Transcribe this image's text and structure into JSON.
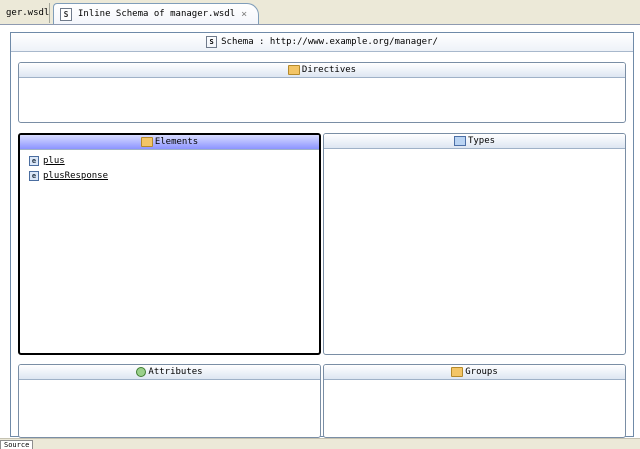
{
  "tabs": [
    {
      "label": "ger.wsdl",
      "active": false
    },
    {
      "label": "Inline Schema of manager.wsdl",
      "active": true,
      "icon": "schema-icon",
      "close": "×"
    }
  ],
  "schema": {
    "icon_letter": "S",
    "title": "Schema : http://www.example.org/manager/"
  },
  "sections": {
    "directives": {
      "title": "Directives",
      "icon": "folder-icon"
    },
    "elements": {
      "title": "Elements",
      "icon": "folder-icon",
      "items": [
        {
          "icon": "element-icon",
          "letter": "e",
          "label": "plus"
        },
        {
          "icon": "element-icon",
          "letter": "e",
          "label": "plusResponse"
        }
      ]
    },
    "types": {
      "title": "Types",
      "icon": "types-icon"
    },
    "attributes": {
      "title": "Attributes",
      "icon": "attribute-icon"
    },
    "groups": {
      "title": "Groups",
      "icon": "folder-icon"
    }
  },
  "status": {
    "tab_label": "Source"
  },
  "colors": {
    "selected_header": "#8c94ff",
    "border": "#7a8ea5",
    "background": "#ece9d8"
  }
}
